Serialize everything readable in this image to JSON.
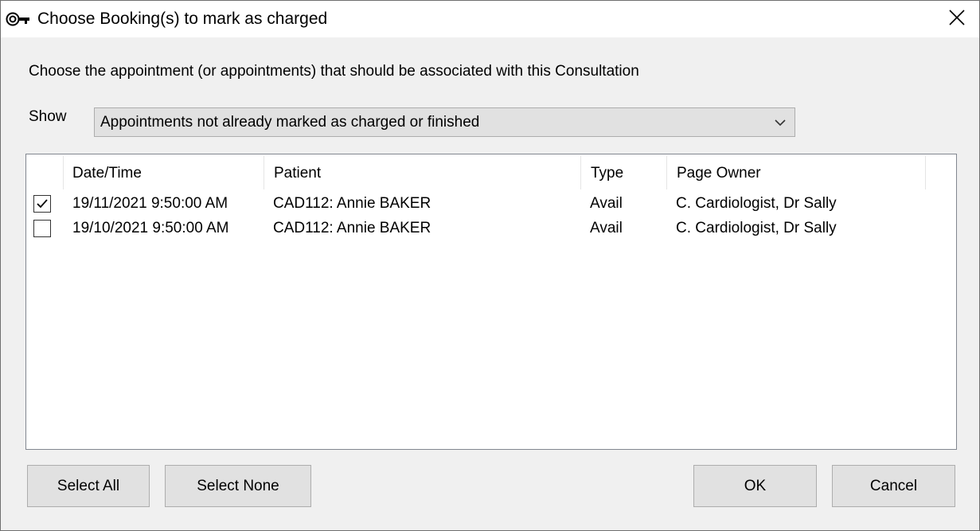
{
  "window": {
    "title": "Choose Booking(s) to mark as charged",
    "icon": "key-icon",
    "close_icon": "close-icon"
  },
  "instruction": "Choose the appointment (or appointments) that should be associated with this Consultation",
  "filter": {
    "label": "Show",
    "selected": "Appointments not already marked as charged or finished"
  },
  "table": {
    "columns": [
      "Date/Time",
      "Patient",
      "Type",
      "Page Owner"
    ],
    "rows": [
      {
        "checked": true,
        "datetime": "19/11/2021 9:50:00 AM",
        "patient": "CAD112: Annie BAKER",
        "type": "Avail",
        "owner": "C. Cardiologist, Dr Sally"
      },
      {
        "checked": false,
        "datetime": "19/10/2021 9:50:00 AM",
        "patient": "CAD112: Annie BAKER",
        "type": "Avail",
        "owner": "C. Cardiologist, Dr Sally"
      }
    ]
  },
  "buttons": {
    "select_all": "Select All",
    "select_none": "Select None",
    "ok": "OK",
    "cancel": "Cancel"
  }
}
